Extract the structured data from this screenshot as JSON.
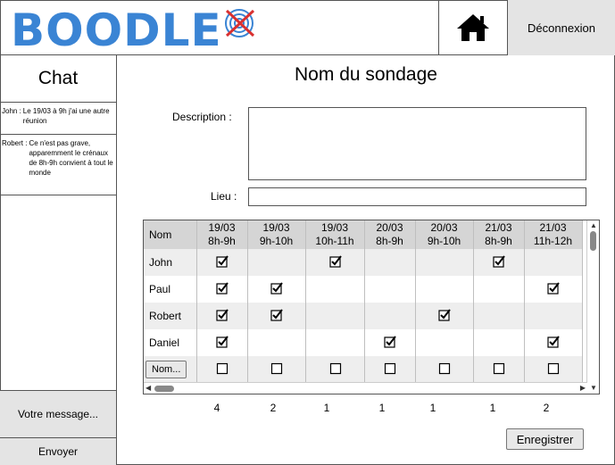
{
  "header": {
    "logo_text": "BOODLE",
    "logout_label": "Déconnexion"
  },
  "chat": {
    "title": "Chat",
    "messages": [
      {
        "who": "John :",
        "text": "Le 19/03 à 9h j'ai une autre réunion"
      },
      {
        "who": "Robert :",
        "text": "Ce n'est pas grave, apparemment le crénaux de 8h-9h convient à tout le monde"
      }
    ],
    "input_label": "Votre message...",
    "send_label": "Envoyer"
  },
  "survey": {
    "title": "Nom du sondage",
    "description_label": "Description :",
    "lieu_label": "Lieu :",
    "save_label": "Enregistrer"
  },
  "grid": {
    "name_header": "Nom",
    "columns": [
      {
        "date": "19/03",
        "time": "8h-9h"
      },
      {
        "date": "19/03",
        "time": "9h-10h"
      },
      {
        "date": "19/03",
        "time": "10h-11h"
      },
      {
        "date": "20/03",
        "time": "8h-9h"
      },
      {
        "date": "20/03",
        "time": "9h-10h"
      },
      {
        "date": "21/03",
        "time": "8h-9h"
      },
      {
        "date": "21/03",
        "time": "11h-12h"
      }
    ],
    "rows": [
      {
        "name": "John",
        "checks": [
          true,
          false,
          true,
          false,
          false,
          true,
          false
        ]
      },
      {
        "name": "Paul",
        "checks": [
          true,
          true,
          false,
          false,
          false,
          false,
          true
        ]
      },
      {
        "name": "Robert",
        "checks": [
          true,
          true,
          false,
          false,
          true,
          false,
          false
        ]
      },
      {
        "name": "Daniel",
        "checks": [
          true,
          false,
          false,
          true,
          false,
          false,
          true
        ]
      }
    ],
    "new_row_button": "Nom...",
    "totals": [
      "4",
      "2",
      "1",
      "1",
      "1",
      "1",
      "2"
    ]
  },
  "colors": {
    "logo_blue": "#3a84d4",
    "logo_mark_red": "#d93030",
    "panel_gray": "#e4e4e4",
    "header_gray": "#d5d5d5"
  }
}
